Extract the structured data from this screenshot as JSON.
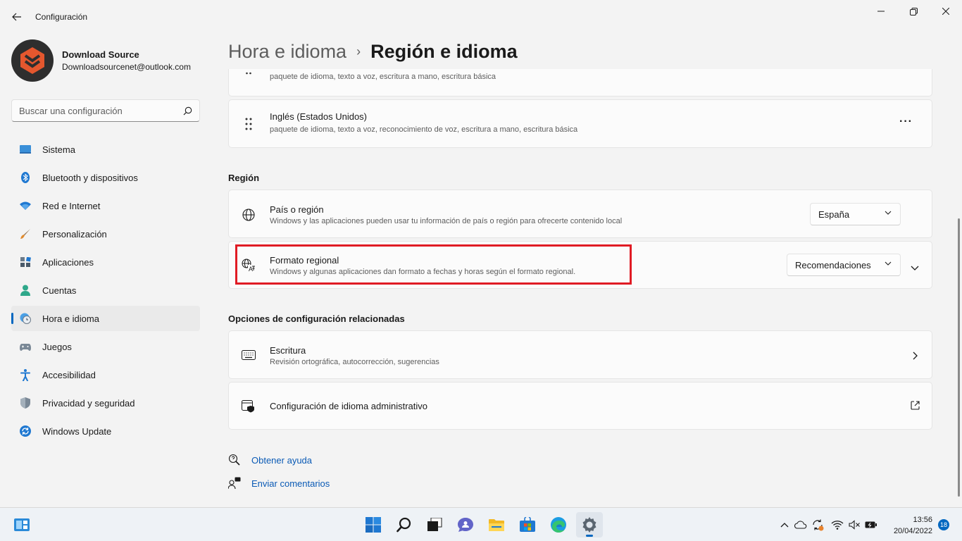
{
  "window": {
    "title": "Configuración",
    "back_icon": "arrow-left-icon",
    "controls": [
      "minimize-icon",
      "restore-icon",
      "close-icon"
    ]
  },
  "profile": {
    "name": "Download Source",
    "email": "Downloadsourcenet@outlook.com"
  },
  "search": {
    "placeholder": "Buscar una configuración",
    "icon": "search-icon"
  },
  "sidebar": {
    "items": [
      {
        "label": "Sistema",
        "icon": "system-icon"
      },
      {
        "label": "Bluetooth y dispositivos",
        "icon": "bluetooth-icon"
      },
      {
        "label": "Red e Internet",
        "icon": "wifi-icon"
      },
      {
        "label": "Personalización",
        "icon": "brush-icon"
      },
      {
        "label": "Aplicaciones",
        "icon": "apps-icon"
      },
      {
        "label": "Cuentas",
        "icon": "account-icon"
      },
      {
        "label": "Hora e idioma",
        "icon": "time-language-icon",
        "active": true
      },
      {
        "label": "Juegos",
        "icon": "gamepad-icon"
      },
      {
        "label": "Accesibilidad",
        "icon": "accessibility-icon"
      },
      {
        "label": "Privacidad y seguridad",
        "icon": "shield-icon"
      },
      {
        "label": "Windows Update",
        "icon": "update-icon"
      }
    ]
  },
  "breadcrumb": {
    "parent": "Hora e idioma",
    "separator": "›",
    "current": "Región e idioma"
  },
  "languages": [
    {
      "title": "",
      "subtitle": "paquete de idioma, texto a voz, escritura a mano, escritura básica"
    },
    {
      "title": "Inglés (Estados Unidos)",
      "subtitle": "paquete de idioma, texto a voz, reconocimiento de voz, escritura a mano, escritura básica",
      "more": "···"
    }
  ],
  "region": {
    "section_label": "Región",
    "country": {
      "title": "País o región",
      "subtitle": "Windows y las aplicaciones pueden usar tu información de país o región para ofrecerte contenido local",
      "value": "España"
    },
    "format": {
      "title": "Formato regional",
      "subtitle": "Windows y algunas aplicaciones dan formato a fechas y horas según el formato regional.",
      "value": "Recomendaciones"
    }
  },
  "related": {
    "section_label": "Opciones de configuración relacionadas",
    "typing": {
      "title": "Escritura",
      "subtitle": "Revisión ortográfica, autocorrección, sugerencias"
    },
    "admin": {
      "title": "Configuración de idioma administrativo"
    }
  },
  "links": {
    "help": "Obtener ayuda",
    "feedback": "Enviar comentarios"
  },
  "taskbar": {
    "apps": [
      "start-icon",
      "search-icon",
      "task-view-icon",
      "chat-icon",
      "file-explorer-icon",
      "store-icon",
      "edge-icon",
      "settings-icon"
    ],
    "time": "13:56",
    "date": "20/04/2022",
    "notifications": "18"
  },
  "colors": {
    "accent": "#0067c0",
    "highlight_box": "#e01b24",
    "link": "#0a5ab5"
  }
}
